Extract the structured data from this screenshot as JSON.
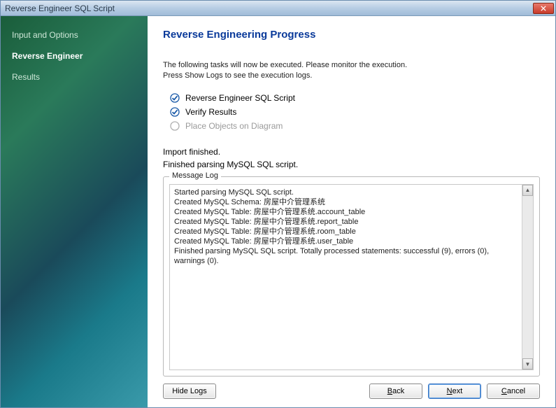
{
  "window": {
    "title": "Reverse Engineer SQL Script"
  },
  "sidebar": {
    "items": [
      {
        "label": "Input and Options"
      },
      {
        "label": "Reverse Engineer"
      },
      {
        "label": "Results"
      }
    ],
    "activeIndex": 1
  },
  "main": {
    "heading": "Reverse Engineering Progress",
    "intro_line1": "The following tasks will now be executed. Please monitor the execution.",
    "intro_line2": "Press Show Logs to see the execution logs.",
    "tasks": [
      {
        "label": "Reverse Engineer SQL Script",
        "state": "done"
      },
      {
        "label": "Verify Results",
        "state": "done"
      },
      {
        "label": "Place Objects on Diagram",
        "state": "pending"
      }
    ],
    "status_line1": "Import finished.",
    "status_line2": "Finished parsing MySQL SQL script.",
    "log_label": "Message Log",
    "log_lines": [
      "Started parsing MySQL SQL script.",
      "Created MySQL Schema: 房屋中介管理系统",
      "Created MySQL Table: 房屋中介管理系统.account_table",
      "Created MySQL Table: 房屋中介管理系统.report_table",
      "Created MySQL Table: 房屋中介管理系统.room_table",
      "Created MySQL Table: 房屋中介管理系统.user_table",
      "Finished parsing MySQL SQL script. Totally processed statements: successful (9), errors (0), warnings (0)."
    ]
  },
  "buttons": {
    "hide_logs": "Hide Logs",
    "back": "Back",
    "next": "Next",
    "cancel": "Cancel"
  }
}
